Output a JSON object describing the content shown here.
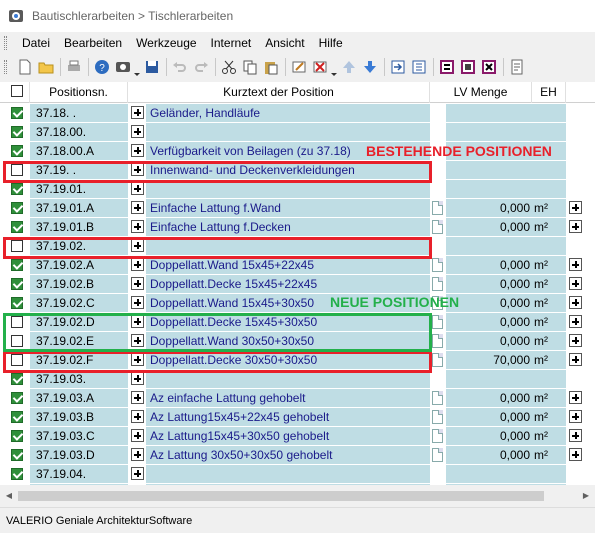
{
  "window": {
    "title": "Bautischlerarbeiten > Tischlerarbeiten"
  },
  "menu": [
    "Datei",
    "Bearbeiten",
    "Werkzeuge",
    "Internet",
    "Ansicht",
    "Hilfe"
  ],
  "columns": {
    "pos": "Positionsn.",
    "text": "Kurztext der Position",
    "menge": "LV Menge",
    "eh": "EH"
  },
  "rows": [
    {
      "pos": "37.18.  .",
      "text": "Geländer, Handläufe",
      "checked": true,
      "menge": "",
      "eh": "",
      "doc": false,
      "plus2": false
    },
    {
      "pos": "37.18.00.",
      "text": "",
      "checked": true,
      "menge": "",
      "eh": "",
      "doc": false,
      "plus2": false
    },
    {
      "pos": "37.18.00.A",
      "text": "Verfügbarkeit von Beilagen (zu 37.18)",
      "checked": true,
      "menge": "",
      "eh": "",
      "doc": false,
      "plus2": false
    },
    {
      "pos": "37.19.  .",
      "text": "Innenwand- und Deckenverkleidungen",
      "checked": false,
      "menge": "",
      "eh": "",
      "doc": false,
      "plus2": false
    },
    {
      "pos": "37.19.01.",
      "text": "",
      "checked": true,
      "menge": "",
      "eh": "",
      "doc": false,
      "plus2": false
    },
    {
      "pos": "37.19.01.A",
      "text": "Einfache Lattung f.Wand",
      "checked": true,
      "menge": "0,000",
      "eh": "m²",
      "doc": true,
      "plus2": true
    },
    {
      "pos": "37.19.01.B",
      "text": "Einfache Lattung f.Decken",
      "checked": true,
      "menge": "0,000",
      "eh": "m²",
      "doc": true,
      "plus2": true
    },
    {
      "pos": "37.19.02.",
      "text": "",
      "checked": false,
      "menge": "",
      "eh": "",
      "doc": false,
      "plus2": false
    },
    {
      "pos": "37.19.02.A",
      "text": "Doppellatt.Wand 15x45+22x45",
      "checked": true,
      "menge": "0,000",
      "eh": "m²",
      "doc": true,
      "plus2": true
    },
    {
      "pos": "37.19.02.B",
      "text": "Doppellatt.Decke 15x45+22x45",
      "checked": true,
      "menge": "0,000",
      "eh": "m²",
      "doc": true,
      "plus2": true
    },
    {
      "pos": "37.19.02.C",
      "text": "Doppellatt.Wand 15x45+30x50",
      "checked": true,
      "menge": "0,000",
      "eh": "m²",
      "doc": true,
      "plus2": true
    },
    {
      "pos": "37.19.02.D",
      "text": "Doppellatt.Decke 15x45+30x50",
      "checked": false,
      "menge": "0,000",
      "eh": "m²",
      "doc": true,
      "plus2": true
    },
    {
      "pos": "37.19.02.E",
      "text": "Doppellatt.Wand 30x50+30x50",
      "checked": false,
      "menge": "0,000",
      "eh": "m²",
      "doc": true,
      "plus2": true
    },
    {
      "pos": "37.19.02.F",
      "text": "Doppellatt.Decke 30x50+30x50",
      "checked": false,
      "menge": "70,000",
      "eh": "m²",
      "doc": true,
      "plus2": true
    },
    {
      "pos": "37.19.03.",
      "text": "",
      "checked": true,
      "menge": "",
      "eh": "",
      "doc": false,
      "plus2": false
    },
    {
      "pos": "37.19.03.A",
      "text": "Az einfache Lattung gehobelt",
      "checked": true,
      "menge": "0,000",
      "eh": "m²",
      "doc": true,
      "plus2": true
    },
    {
      "pos": "37.19.03.B",
      "text": "Az Lattung15x45+22x45 gehobelt",
      "checked": true,
      "menge": "0,000",
      "eh": "m²",
      "doc": true,
      "plus2": true
    },
    {
      "pos": "37.19.03.C",
      "text": "Az Lattung15x45+30x50 gehobelt",
      "checked": true,
      "menge": "0,000",
      "eh": "m²",
      "doc": true,
      "plus2": true
    },
    {
      "pos": "37.19.03.D",
      "text": "Az Lattung 30x50+30x50 gehobelt",
      "checked": true,
      "menge": "0,000",
      "eh": "m²",
      "doc": true,
      "plus2": true
    },
    {
      "pos": "37.19.04.",
      "text": "",
      "checked": true,
      "menge": "",
      "eh": "",
      "doc": false,
      "plus2": false
    },
    {
      "pos": "",
      "text": "",
      "checked": true,
      "menge": "",
      "eh": "",
      "doc": false,
      "plus2": false
    }
  ],
  "annotations": {
    "existing": "BESTEHENDE POSITIONEN",
    "new": "NEUE POSITIONEN"
  },
  "colors": {
    "row_bg": "#bfdde4",
    "annotation_red": "#e8202a",
    "annotation_green": "#23b04a",
    "checkbox_green": "#2f8f3a"
  },
  "status": "VALERIO Geniale ArchitekturSoftware"
}
